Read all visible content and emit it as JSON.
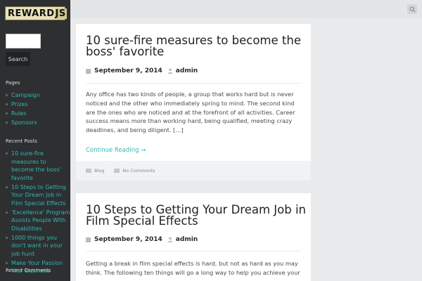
{
  "logo": {
    "text_main": "REWARD",
    "text_js": "JS"
  },
  "sidebar": {
    "search_label": "Search",
    "pages_heading": "Pages",
    "pages": [
      "Campaign",
      "Prizes",
      "Rules",
      "Sponsors"
    ],
    "recent_posts_heading": "Recent Posts",
    "recent_posts": [
      "10 sure-fire measures to become the boss' favorite",
      "10 Steps to Getting Your Dream Job in Film Special Effects",
      "'Excellence' Program Assists People With Disabilities",
      "1000 things you don't want in your job hunt",
      "Make Your Passion Your Business"
    ],
    "recent_comments_heading": "Recent Comments"
  },
  "posts": [
    {
      "title": "10 sure-fire measures to become the boss' favorite",
      "date": "September 9, 2014",
      "author": "admin",
      "excerpt": "Any office has two kinds of people, a group that works hard but is never noticed and the other who immediately spring to mind. The second kind are the ones who are noticed and at the forefront of all activities. Career success means more than working hard, being qualified, meeting crazy deadlines, and being diligent. […]",
      "continue": "Continue Reading →",
      "category": "Blog",
      "comments": "No Comments"
    },
    {
      "title": "10 Steps to Getting Your Dream Job in Film Special Effects",
      "date": "September 9, 2014",
      "author": "admin",
      "excerpt": "Getting a break in film special effects is hard, but not as hard as you may think. The following ten things will go a long way to help you achieve your"
    }
  ]
}
